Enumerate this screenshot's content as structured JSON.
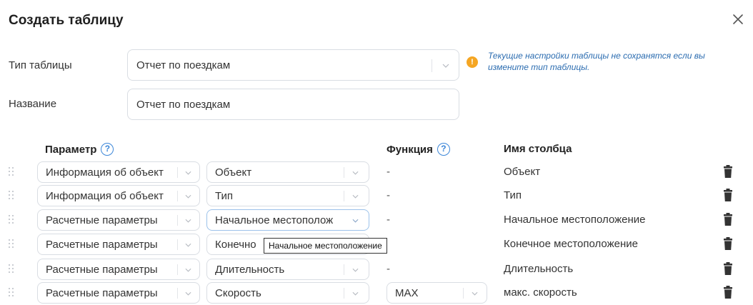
{
  "dialog": {
    "title": "Создать таблицу"
  },
  "form": {
    "type_label": "Тип таблицы",
    "type_value": "Отчет по поездкам",
    "name_label": "Название",
    "name_value": "Отчет по поездкам",
    "warning": "Текущие настройки таблицы не сохранятся если вы измените тип таблицы."
  },
  "columns": {
    "param": "Параметр",
    "function": "Функция",
    "colname": "Имя столбца",
    "help_glyph": "?"
  },
  "rows": [
    {
      "group": "Информация об объект",
      "param": "Объект",
      "function": "-",
      "colname": "Объект"
    },
    {
      "group": "Информация об объект",
      "param": "Тип",
      "function": "-",
      "colname": "Тип"
    },
    {
      "group": "Расчетные параметры",
      "param": "Начальное местополож",
      "function": "-",
      "colname": "Начальное местоположение"
    },
    {
      "group": "Расчетные параметры",
      "param": "Конечно",
      "function": "",
      "colname": "Конечное местоположение"
    },
    {
      "group": "Расчетные параметры",
      "param": "Длительность",
      "function": "-",
      "colname": "Длительность"
    },
    {
      "group": "Расчетные параметры",
      "param": "Скорость",
      "function": "MAX",
      "colname": "макс. скорость"
    }
  ],
  "tooltip": "Начальное местоположение",
  "icons": {
    "close": "close-icon",
    "warning": "warning-icon",
    "drag": "drag-handle-icon",
    "trash": "trash-icon",
    "help": "help-icon",
    "chevron": "chevron-down-icon"
  },
  "colors": {
    "warning": "#f5a623",
    "info_text": "#2b6cb0",
    "help": "#3b86d8"
  }
}
